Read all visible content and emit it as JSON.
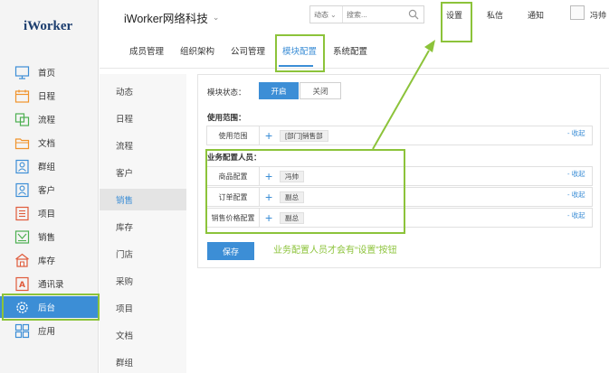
{
  "app": {
    "logo": "iWorker",
    "company": "iWorker网络科技"
  },
  "header": {
    "search_type": "动态",
    "search_placeholder": "搜索...",
    "links": {
      "settings": "设置",
      "messages": "私信",
      "notifications": "通知"
    },
    "username": "冯帅"
  },
  "sidebar": {
    "items": [
      {
        "label": "首页",
        "icon": "monitor-icon"
      },
      {
        "label": "日程",
        "icon": "calendar-icon"
      },
      {
        "label": "流程",
        "icon": "flow-icon"
      },
      {
        "label": "文档",
        "icon": "folder-icon"
      },
      {
        "label": "群组",
        "icon": "group-icon"
      },
      {
        "label": "客户",
        "icon": "customer-icon"
      },
      {
        "label": "项目",
        "icon": "project-icon"
      },
      {
        "label": "销售",
        "icon": "sales-icon"
      },
      {
        "label": "库存",
        "icon": "warehouse-icon"
      },
      {
        "label": "通讯录",
        "icon": "contacts-icon"
      },
      {
        "label": "后台",
        "icon": "gear-icon"
      },
      {
        "label": "应用",
        "icon": "apps-grid-icon"
      }
    ],
    "active": "后台"
  },
  "subnav": {
    "items": [
      "动态",
      "日程",
      "流程",
      "客户",
      "销售",
      "库存",
      "门店",
      "采购",
      "项目",
      "文档",
      "群组"
    ],
    "active": "销售"
  },
  "tabs": {
    "items": [
      "成员管理",
      "组织架构",
      "公司管理",
      "模块配置",
      "系统配置"
    ],
    "active": "模块配置"
  },
  "module": {
    "status_label": "模块状态：",
    "on": "开启",
    "off": "关闭",
    "scope_title": "使用范围：",
    "scope_row": {
      "label": "使用范围",
      "tag": "[部门]销售部",
      "collapse": "- 收起"
    },
    "config_title": "业务配置人员：",
    "config_rows": [
      {
        "label": "商品配置",
        "tag": "冯帅",
        "collapse": "- 收起"
      },
      {
        "label": "订单配置",
        "tag": "副总",
        "collapse": "- 收起"
      },
      {
        "label": "销售价格配置",
        "tag": "副总",
        "collapse": "- 收起"
      }
    ],
    "save": "保存"
  },
  "annotation": {
    "text": "业务配置人员才会有“设置”按钮",
    "color": "#8cc33a"
  },
  "colors": {
    "accent": "#3c8ed6",
    "annotation": "#8cc33a"
  }
}
